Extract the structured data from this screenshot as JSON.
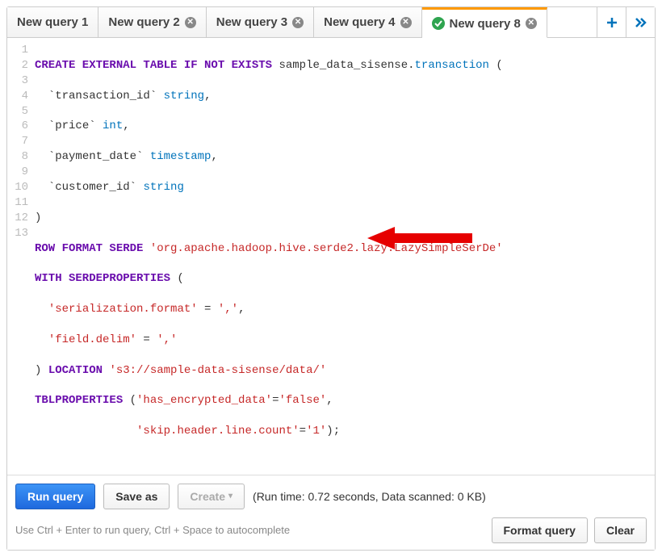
{
  "tabs": [
    {
      "label": "New query 1",
      "closable": false
    },
    {
      "label": "New query 2",
      "closable": true
    },
    {
      "label": "New query 3",
      "closable": true
    },
    {
      "label": "New query 4",
      "closable": true
    }
  ],
  "active_tab": {
    "label": "New query 8",
    "status_icon": "success"
  },
  "code": {
    "line_count": 13,
    "tokens": {
      "kw_create_external_table_if_not_exists": "CREATE EXTERNAL TABLE IF NOT EXISTS",
      "db_name": "sample_data_sisense",
      "dot": ".",
      "tbl_name": "transaction",
      "open_paren": " (",
      "col1_id": "`transaction_id`",
      "ty_string1": "string",
      "comma": ",",
      "col2_id": "`price`",
      "ty_int": "int",
      "col3_id": "`payment_date`",
      "ty_ts": "timestamp",
      "col4_id": "`customer_id`",
      "ty_string2": "string",
      "close_paren": ")",
      "kw_row_format_serde": "ROW FORMAT SERDE",
      "str_serde": "'org.apache.hadoop.hive.serde2.lazy.LazySimpleSerDe'",
      "kw_with_serdeprops": "WITH SERDEPROPERTIES",
      "str_serfmt_key": "'serialization.format'",
      "eq": " = ",
      "str_comma1": "','",
      "str_delim_key": "'field.delim'",
      "str_comma2": "','",
      "kw_location": "LOCATION",
      "str_location": "'s3://sample-data-sisense/data/'",
      "kw_tblprops": "TBLPROPERTIES",
      "str_enc_key": "'has_encrypted_data'",
      "eq2": "=",
      "str_false": "'false'",
      "str_skip_key": "'skip.header.line.count'",
      "str_one": "'1'",
      "tail": ");"
    }
  },
  "footer": {
    "run_label": "Run query",
    "save_label": "Save as",
    "create_label": "Create",
    "status": "(Run time: 0.72 seconds, Data scanned: 0 KB)",
    "hint": "Use Ctrl + Enter to run query, Ctrl + Space to autocomplete",
    "format_label": "Format query",
    "clear_label": "Clear"
  }
}
